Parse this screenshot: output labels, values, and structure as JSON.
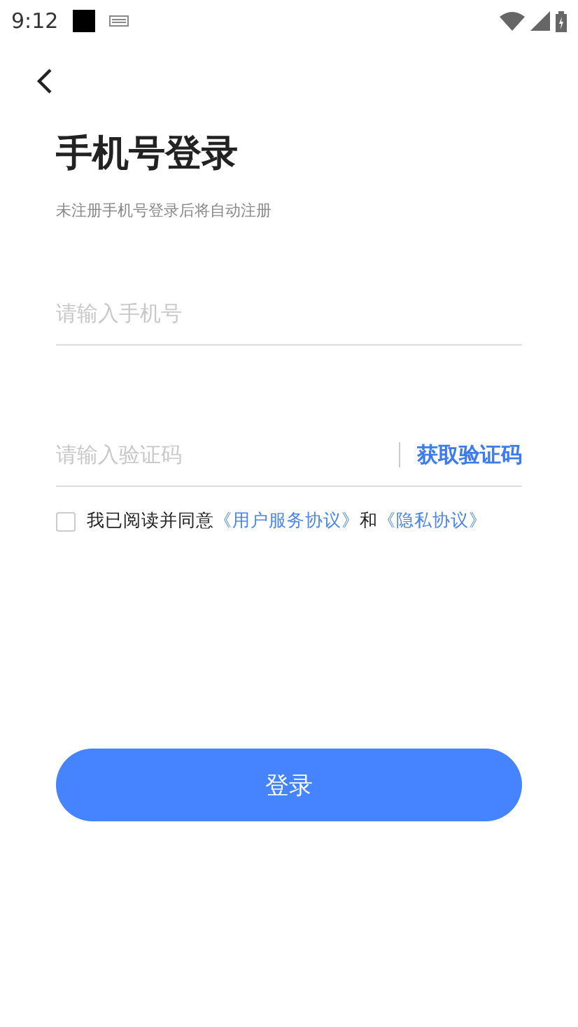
{
  "status_bar": {
    "time": "9:12"
  },
  "title": "手机号登录",
  "subtitle": "未注册手机号登录后将自动注册",
  "phone_field": {
    "placeholder": "请输入手机号"
  },
  "code_field": {
    "placeholder": "请输入验证码",
    "action": "获取验证码"
  },
  "agreement": {
    "checked": false,
    "parts": [
      {
        "kind": "text",
        "text": "我已阅读并同意"
      },
      {
        "kind": "link",
        "text": "《用户服务协议》"
      },
      {
        "kind": "text",
        "text": "和"
      },
      {
        "kind": "link",
        "text": "《隐私协议》"
      }
    ]
  },
  "login_button": "登录"
}
